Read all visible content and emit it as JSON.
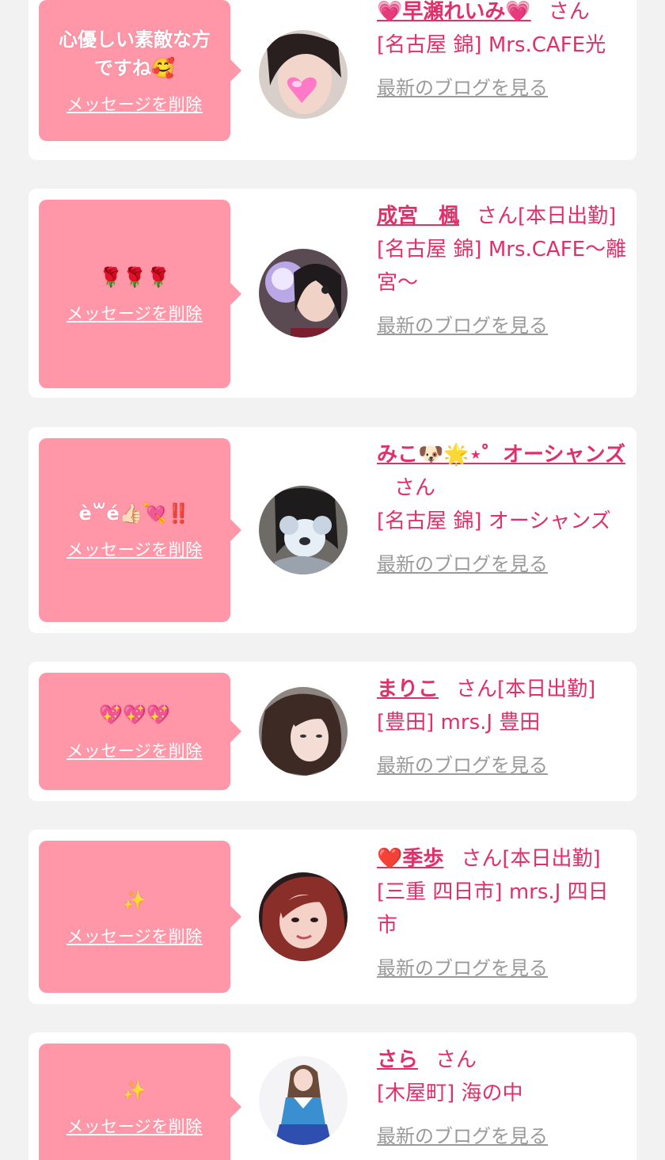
{
  "common": {
    "delete_label": "メッセージを削除",
    "blog_label": "最新のブログを見る",
    "san": "さん"
  },
  "colors": {
    "bubble": "#ff97a8",
    "accent": "#e0306a",
    "muted": "#9a9a9a",
    "background": "#f2f2f2"
  },
  "cards": [
    {
      "message": "心優しい素敵な方ですね🥰",
      "name": "💗早瀬れいみ💗",
      "status": "",
      "shop": "[名古屋 錦] Mrs.CAFE光",
      "avatar_icon": "avatar-heart-girl-icon"
    },
    {
      "message": "🌹🌹🌹",
      "name": "成宮　楓",
      "status": "[本日出勤]",
      "shop": "[名古屋 錦] Mrs.CAFE〜離宮〜",
      "avatar_icon": "avatar-purple-doll-icon"
    },
    {
      "message": "è꒳é👍🏻💘‼️",
      "name": "みこ🐶🌟⋆゜オーシャンズ",
      "status": "",
      "shop": "[名古屋 錦] オーシャンズ",
      "avatar_icon": "avatar-koala-mask-icon"
    },
    {
      "message": "💖💖💖",
      "name": "まりこ",
      "status": "[本日出勤]",
      "shop": "[豊田] mrs.J 豊田",
      "avatar_icon": "avatar-wavy-hair-icon"
    },
    {
      "message": "✨",
      "name": "❤️季歩",
      "status": "[本日出勤]",
      "shop": "[三重 四日市] mrs.J 四日市",
      "avatar_icon": "avatar-red-hair-icon"
    },
    {
      "message": "✨",
      "name": "さら",
      "status": "",
      "shop": "[木屋町] 海の中",
      "avatar_icon": "avatar-blue-uniform-icon"
    }
  ]
}
